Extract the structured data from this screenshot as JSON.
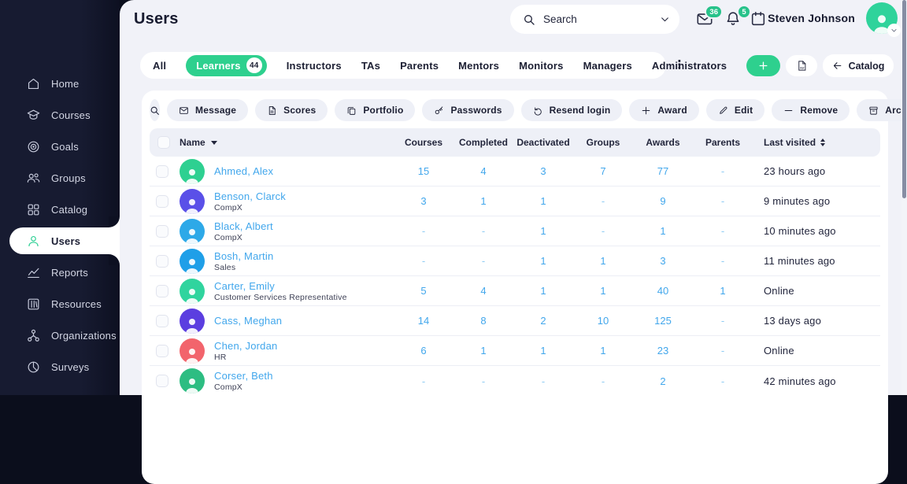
{
  "sidebar": {
    "items": [
      {
        "label": "Home",
        "icon": "home",
        "active": false
      },
      {
        "label": "Courses",
        "icon": "courses",
        "active": false
      },
      {
        "label": "Goals",
        "icon": "goals",
        "active": false
      },
      {
        "label": "Groups",
        "icon": "groups",
        "active": false
      },
      {
        "label": "Catalog",
        "icon": "catalog",
        "active": false
      },
      {
        "label": "Users",
        "icon": "users",
        "active": true
      },
      {
        "label": "Reports",
        "icon": "reports",
        "active": false
      },
      {
        "label": "Resources",
        "icon": "resources",
        "active": false
      },
      {
        "label": "Organizations",
        "icon": "organizations",
        "active": false
      },
      {
        "label": "Surveys",
        "icon": "surveys",
        "active": false
      }
    ]
  },
  "header": {
    "title": "Users",
    "search_label": "Search",
    "mail_badge": "36",
    "bell_badge": "5",
    "user_name": "Steven Johnson"
  },
  "tabs": {
    "items": [
      "All",
      "Learners",
      "Instructors",
      "TAs",
      "Parents",
      "Mentors",
      "Monitors",
      "Managers",
      "Administrators"
    ],
    "active": "Learners",
    "active_count": "44"
  },
  "actions": {
    "catalog_label": "Catalog"
  },
  "toolbar": {
    "buttons": [
      {
        "label": "Message",
        "icon": "envelope"
      },
      {
        "label": "Scores",
        "icon": "file"
      },
      {
        "label": "Portfolio",
        "icon": "copy"
      },
      {
        "label": "Passwords",
        "icon": "key"
      },
      {
        "label": "Resend login",
        "icon": "undo"
      },
      {
        "label": "Award",
        "icon": "plus"
      },
      {
        "label": "Edit",
        "icon": "pencil"
      },
      {
        "label": "Remove",
        "icon": "minus"
      },
      {
        "label": "Archive",
        "icon": "archive"
      }
    ]
  },
  "table": {
    "columns": [
      "Name",
      "Courses",
      "Completed",
      "Deactivated",
      "Groups",
      "Awards",
      "Parents",
      "Last visited"
    ],
    "rows": [
      {
        "name": "Ahmed, Alex",
        "subtitle": "",
        "avatar_color": "#2ed091",
        "values": [
          "15",
          "4",
          "3",
          "7",
          "77",
          "-"
        ],
        "last_visited": "23 hours ago"
      },
      {
        "name": "Benson, Clarck",
        "subtitle": "CompX",
        "avatar_color": "#5a50e8",
        "values": [
          "3",
          "1",
          "1",
          "-",
          "9",
          "-"
        ],
        "last_visited": "9 minutes ago"
      },
      {
        "name": "Black, Albert",
        "subtitle": "CompX",
        "avatar_color": "#2da9e8",
        "values": [
          "-",
          "-",
          "1",
          "-",
          "1",
          "-"
        ],
        "last_visited": "10 minutes ago"
      },
      {
        "name": "Bosh, Martin",
        "subtitle": "Sales",
        "avatar_color": "#1f9fe8",
        "values": [
          "-",
          "-",
          "1",
          "1",
          "3",
          "-"
        ],
        "last_visited": "11 minutes ago"
      },
      {
        "name": "Carter, Emily",
        "subtitle": "Customer Services Representative",
        "avatar_color": "#30d49e",
        "values": [
          "5",
          "4",
          "1",
          "1",
          "40",
          "1"
        ],
        "last_visited": "Online"
      },
      {
        "name": "Cass, Meghan",
        "subtitle": "",
        "avatar_color": "#5b3ee0",
        "values": [
          "14",
          "8",
          "2",
          "10",
          "125",
          "-"
        ],
        "last_visited": "13 days ago"
      },
      {
        "name": "Chen, Jordan",
        "subtitle": "HR",
        "avatar_color": "#f2646c",
        "values": [
          "6",
          "1",
          "1",
          "1",
          "23",
          "-"
        ],
        "last_visited": "Online"
      },
      {
        "name": "Corser, Beth",
        "subtitle": "CompX",
        "avatar_color": "#2dbd82",
        "values": [
          "-",
          "-",
          "-",
          "-",
          "2",
          "-"
        ],
        "last_visited": "42 minutes ago"
      }
    ]
  },
  "colors": {
    "accent_green": "#2ed08e",
    "badge_green": "#27c28a",
    "link_blue": "#42a7ec",
    "sidebar_bg": "#171b31",
    "content_bg": "#f1f2f8"
  }
}
